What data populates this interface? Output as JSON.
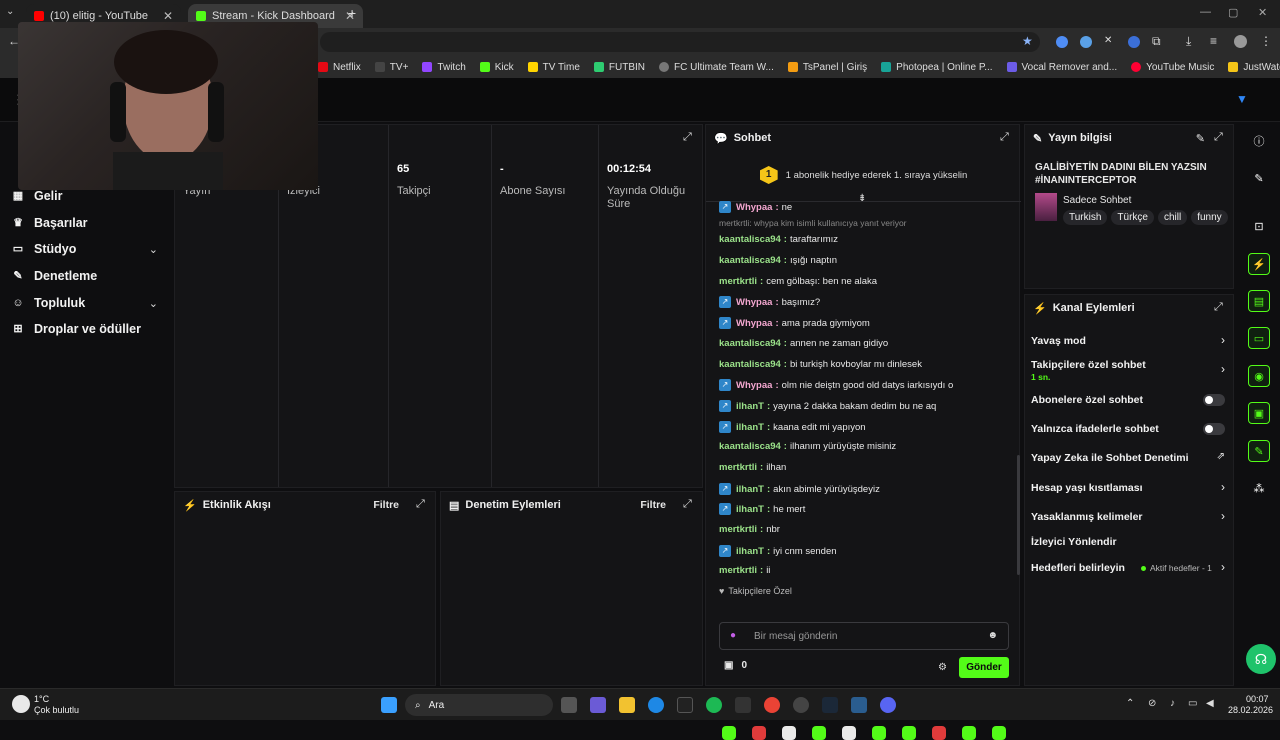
{
  "browser": {
    "tabs": [
      {
        "label": "(10) elitig - YouTube"
      },
      {
        "label": "Stream - Kick Dashboard"
      }
    ],
    "new_tab": "+",
    "bookmarks": [
      "Netflix",
      "TV+",
      "Twitch",
      "Kick",
      "TV Time",
      "FUTBIN",
      "FC Ultimate Team W...",
      "TsPanel | Giriş",
      "Photopea | Online P...",
      "Vocal Remover and...",
      "YouTube Music",
      "JustWatch - The Str..."
    ]
  },
  "sidebar": {
    "items": [
      {
        "label": "Gelir"
      },
      {
        "label": "Başarılar"
      },
      {
        "label": "Stüdyo"
      },
      {
        "label": "Denetleme"
      },
      {
        "label": "Topluluk"
      },
      {
        "label": "Droplar ve ödüller"
      }
    ]
  },
  "stats": [
    {
      "value": "",
      "label": "Yayın"
    },
    {
      "value": "",
      "label": "İzleyici"
    },
    {
      "value": "65",
      "label": "Takipçi"
    },
    {
      "value": "-",
      "label": "Abone Sayısı"
    },
    {
      "value": "00:12:54",
      "label": "Yayında Olduğu Süre"
    }
  ],
  "activity_feed": {
    "title": "Etkinlik Akışı",
    "filter": "Filtre"
  },
  "mod_actions": {
    "title": "Denetim Eylemleri",
    "filter": "Filtre"
  },
  "chat": {
    "title": "Sohbet",
    "gift_banner": "1 abonelik hediye ederek 1. sıraya yükselin",
    "gift_rank": "1",
    "reply_note": "mertkrtli: whypa kim isimli kullanıcıya yanıt veriyor",
    "messages": [
      {
        "user": "Whypaa",
        "text": "ne",
        "badge": true,
        "color": "#f4a7d0"
      },
      {
        "user": "kaantalisca94",
        "text": "taraftarımız",
        "badge": false,
        "color": "#9be28a"
      },
      {
        "user": "kaantalisca94",
        "text": "ışığı naptın",
        "badge": false,
        "color": "#9be28a"
      },
      {
        "user": "mertkrtli",
        "text": "cem gölbaşı: ben ne alaka",
        "badge": false,
        "color": "#9be28a"
      },
      {
        "user": "Whypaa",
        "text": "başımız?",
        "badge": true,
        "color": "#f4a7d0"
      },
      {
        "user": "Whypaa",
        "text": "ama prada giymiyom",
        "badge": true,
        "color": "#f4a7d0"
      },
      {
        "user": "kaantalisca94",
        "text": "annen ne zaman gidiyo",
        "badge": false,
        "color": "#9be28a"
      },
      {
        "user": "kaantalisca94",
        "text": "bi turkişh kovboylar mı dinlesek",
        "badge": false,
        "color": "#9be28a"
      },
      {
        "user": "Whypaa",
        "text": "olm nie deiştn good old datys iarkısıydı o",
        "badge": true,
        "color": "#f4a7d0"
      },
      {
        "user": "ilhanT",
        "text": "yayına 2 dakka bakam dedim bu ne aq",
        "badge": true,
        "color": "#9be28a"
      },
      {
        "user": "ilhanT",
        "text": "kaana edit mi yapıyon",
        "badge": true,
        "color": "#9be28a"
      },
      {
        "user": "kaantalisca94",
        "text": "ilhanım yürüyüşte misiniz",
        "badge": false,
        "color": "#9be28a"
      },
      {
        "user": "mertkrtli",
        "text": "ilhan",
        "badge": false,
        "color": "#9be28a"
      },
      {
        "user": "ilhanT",
        "text": "akın abimle yürüyüşdeyiz",
        "badge": true,
        "color": "#9be28a"
      },
      {
        "user": "ilhanT",
        "text": "he mert",
        "badge": true,
        "color": "#9be28a"
      },
      {
        "user": "mertkrtli",
        "text": "nbr",
        "badge": false,
        "color": "#9be28a"
      },
      {
        "user": "ilhanT",
        "text": "iyi cnm senden",
        "badge": true,
        "color": "#9be28a"
      },
      {
        "user": "mertkrtli",
        "text": "ii",
        "badge": false,
        "color": "#9be28a"
      }
    ],
    "followers_only_label": "Takipçilere Özel",
    "input_placeholder": "Bir mesaj gönderin",
    "points": "0",
    "send_label": "Gönder"
  },
  "stream_info": {
    "title": "Yayın bilgisi",
    "stream_title": "GALİBİYETİN DADINI BİLEN YAZSIN #İNANINTERCEPTOR",
    "category": "Sadece Sohbet",
    "tags": [
      "Turkish",
      "Türkçe",
      "chill",
      "funny"
    ]
  },
  "channel_actions": {
    "title": "Kanal Eylemleri",
    "items": [
      {
        "label": "Yavaş mod"
      },
      {
        "label": "Takipçilere özel sohbet",
        "sub": "1 sn."
      },
      {
        "label": "Abonelere özel sohbet"
      },
      {
        "label": "Yalnızca ifadelerle sohbet"
      },
      {
        "label": "Yapay Zeka ile Sohbet Denetimi"
      },
      {
        "label": "Hesap yaşı kısıtlaması"
      },
      {
        "label": "Yasaklanmış kelimeler"
      },
      {
        "label": "İzleyici Yönlendir"
      },
      {
        "label": "Hedefleri belirleyin",
        "sub": "Aktif hedefler - 1"
      }
    ]
  },
  "taskbar": {
    "weather_temp": "1°C",
    "weather_desc": "Çok bulutlu",
    "search_label": "Ara",
    "time": "00:07",
    "date": "28.02.2026"
  },
  "colors": {
    "accent": "#53fc18",
    "badge": "#2f86c9",
    "bg": "#0e0e10",
    "panel": "#141416"
  }
}
